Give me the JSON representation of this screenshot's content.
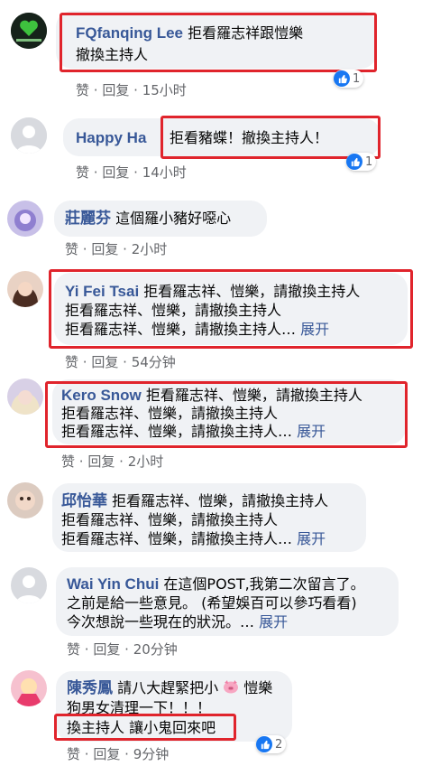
{
  "ui": {
    "like": "赞",
    "reply": "回复",
    "dot": "·",
    "see_more": "展开"
  },
  "comments": [
    {
      "name": "FQfanqing Lee",
      "lines": [
        "拒看羅志祥跟愷樂",
        "撤換主持人"
      ],
      "time": "15小时",
      "reactions": "1"
    },
    {
      "name": "Happy Ha",
      "lines": [
        "拒看豬蝶！撤換主持人！"
      ],
      "time": "14小时",
      "reactions": "1"
    },
    {
      "name": "莊麗芬",
      "lines": [
        "這個羅小豬好噁心"
      ],
      "time": "2小时"
    },
    {
      "name": "Yi Fei Tsai",
      "lines": [
        "拒看羅志祥、愷樂，請撤換主持人",
        "拒看羅志祥、愷樂，請撤換主持人",
        "拒看羅志祥、愷樂，請撤換主持人…"
      ],
      "time": "54分钟"
    },
    {
      "name": "Kero Snow",
      "lines": [
        "拒看羅志祥、愷樂，請撤換主持人",
        "拒看羅志祥、愷樂，請撤換主持人",
        "拒看羅志祥、愷樂，請撤換主持人…"
      ],
      "time": "2小时"
    },
    {
      "name": "邱怡華",
      "lines": [
        "拒看羅志祥、愷樂，請撤換主持人",
        "拒看羅志祥、愷樂，請撤換主持人",
        "拒看羅志祥、愷樂，請撤換主持人…"
      ]
    },
    {
      "name": "Wai Yin Chui",
      "lines": [
        "在這個POST,我第二次留言了。",
        "之前是給一些意見。 (希望娛百可以參巧看看)",
        "今次想說一些現在的狀況。…"
      ],
      "time": "20分钟"
    },
    {
      "name": "陳秀鳳",
      "lines": [
        "請八大趕緊把小",
        "愷樂",
        "狗男女清理一下！！！",
        "換主持人 讓小鬼回來吧"
      ],
      "time": "9分钟",
      "reactions": "2"
    }
  ]
}
